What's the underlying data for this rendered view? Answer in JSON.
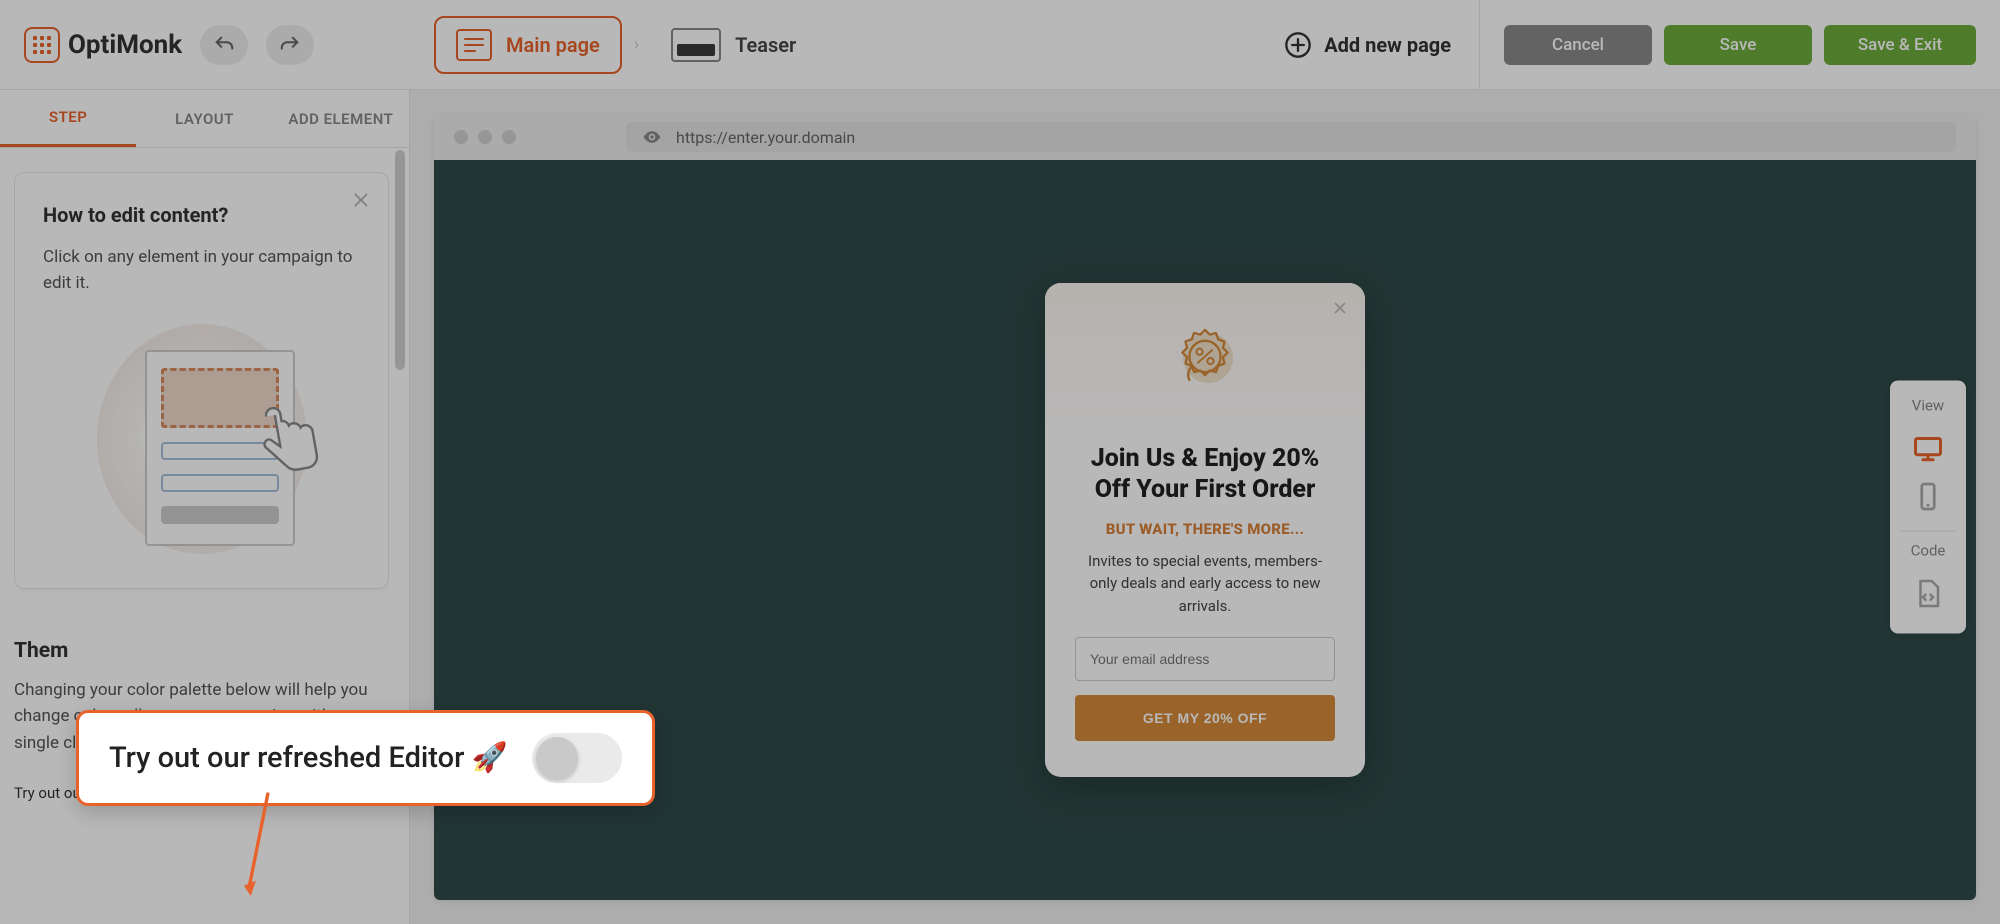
{
  "brand": {
    "name": "OptiMonk"
  },
  "header": {
    "pages": {
      "main": "Main page",
      "teaser": "Teaser"
    },
    "add_page": "Add new page",
    "actions": {
      "cancel": "Cancel",
      "save": "Save",
      "save_exit": "Save & Exit"
    }
  },
  "sidebar": {
    "tabs": {
      "step": "Step",
      "layout": "Layout",
      "add_element": "Add Element"
    },
    "tip": {
      "title": "How to edit content?",
      "body": "Click on any element in your campaign to edit it."
    },
    "theme": {
      "title": "Them",
      "body": "Changing your color palette below will help you change colors all over your campaign with a single click."
    },
    "try_label": "Try out our refreshed Editor 🚀"
  },
  "browser": {
    "url": "https://enter.your.domain"
  },
  "popup": {
    "headline": "Join Us & Enjoy 20% Off Your First Order",
    "subhead": "BUT WAIT, THERE'S MORE...",
    "desc": "Invites to special events, members-only deals and early access to new arrivals.",
    "email_placeholder": "Your email address",
    "cta": "GET MY 20% OFF"
  },
  "view_rail": {
    "view": "View",
    "code": "Code"
  },
  "callout": {
    "text": "Try out our refreshed Editor 🚀"
  }
}
